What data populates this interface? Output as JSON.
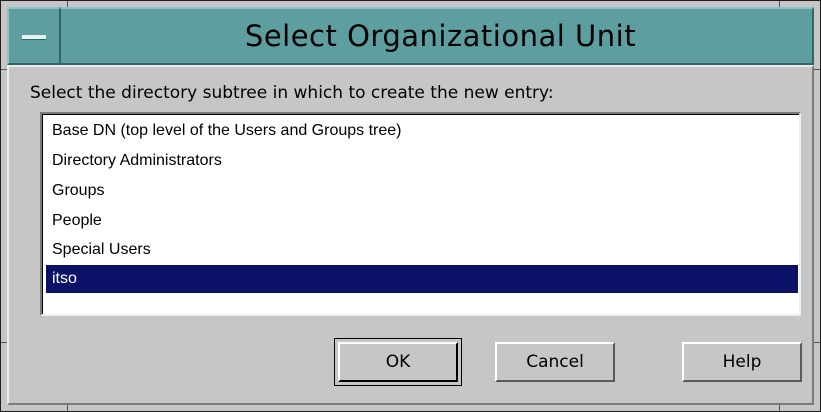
{
  "window": {
    "title": "Select Organizational Unit"
  },
  "dialog": {
    "prompt": "Select the directory subtree in which to create the new entry:",
    "list": {
      "items": [
        "Base DN (top level of the Users and Groups tree)",
        "Directory Administrators",
        "Groups",
        "People",
        "Special Users",
        "itso"
      ],
      "selected": "itso"
    },
    "buttons": {
      "ok": "OK",
      "cancel": "Cancel",
      "help": "Help"
    }
  },
  "icons": {
    "window_menu": "window-menu-icon"
  },
  "colors": {
    "titlebar": "#5f9ea0",
    "selection": "#0a1166",
    "dialog_background": "#c6c6c6"
  }
}
